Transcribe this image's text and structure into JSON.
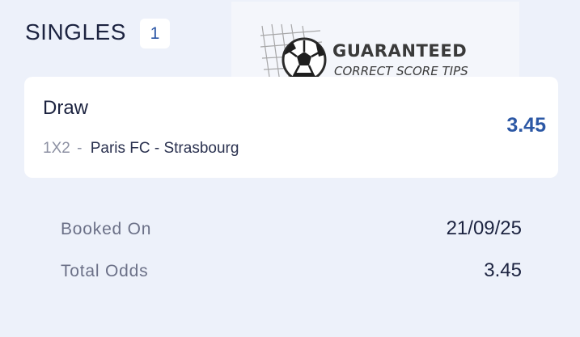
{
  "section": {
    "title": "SINGLES",
    "count": "1"
  },
  "promo": {
    "line1": "GUARANTEED",
    "line2": "CORRECT SCORE TIPS",
    "icon": "soccer-ball-in-net-icon"
  },
  "bet": {
    "selection": "Draw",
    "market": "1X2",
    "separator": "-",
    "match": "Paris FC - Strasbourg",
    "odds": "3.45"
  },
  "summary": {
    "booked_label": "Booked On",
    "booked_value": "21/09/25",
    "total_odds_label": "Total Odds",
    "total_odds_value": "3.45"
  },
  "colors": {
    "background": "#edf1fa",
    "card": "#ffffff",
    "accent": "#2c58a5",
    "text": "#1c2340",
    "muted": "#6b7087"
  }
}
